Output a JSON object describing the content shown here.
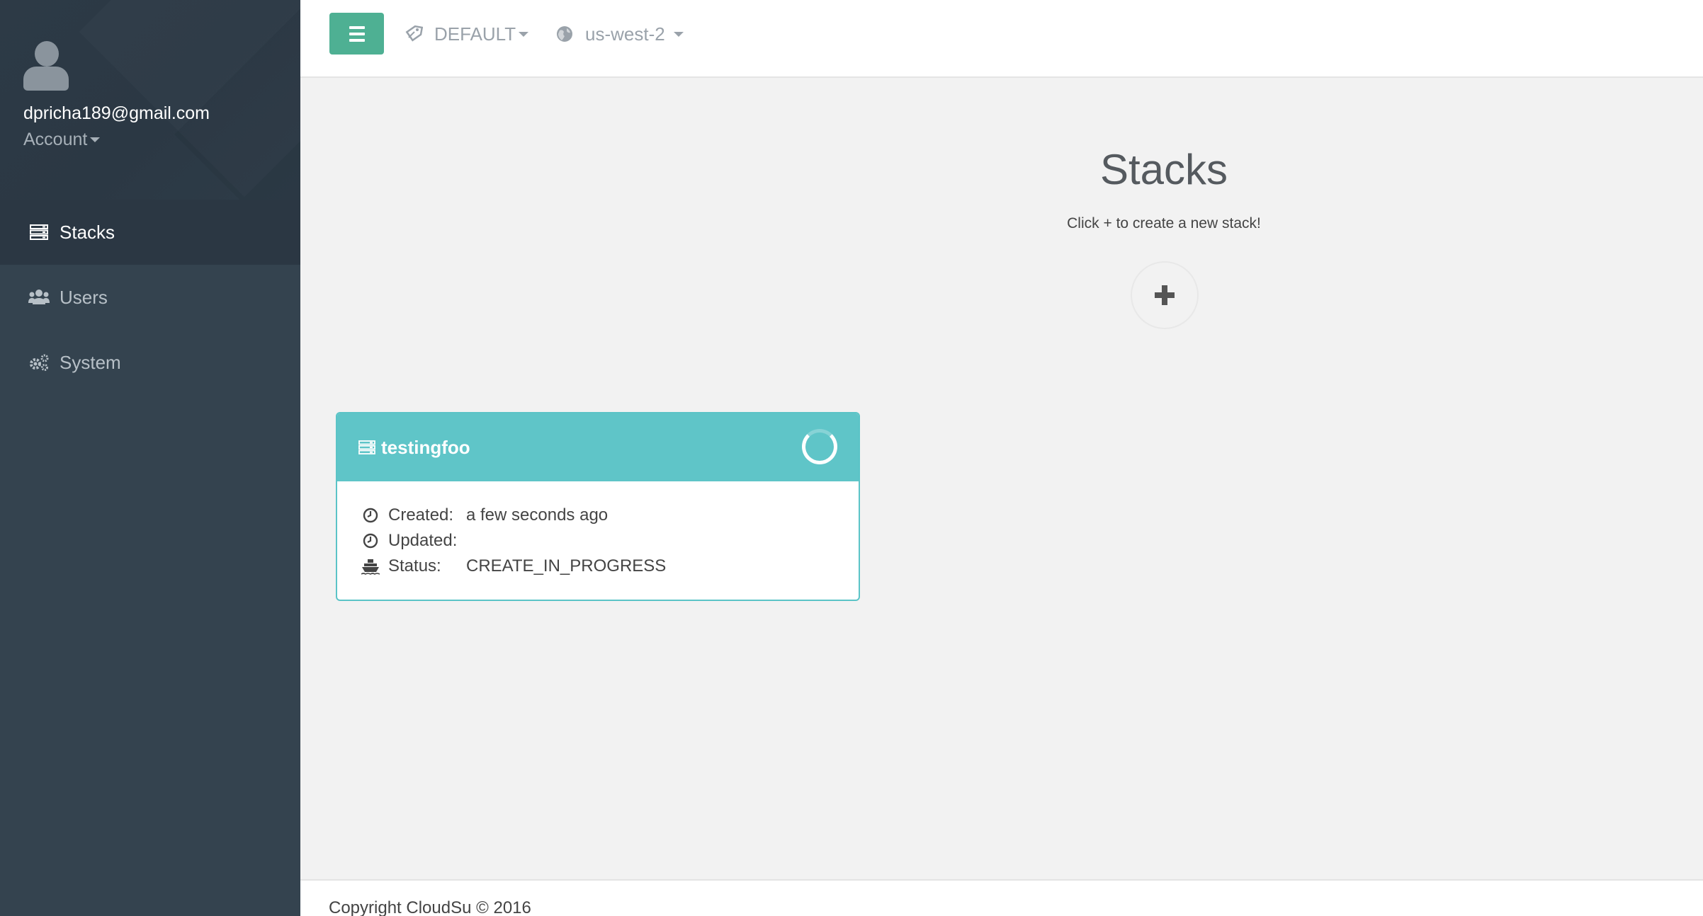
{
  "sidebar": {
    "user_email": "dpricha189@gmail.com",
    "account_label": "Account",
    "items": [
      {
        "label": "Stacks",
        "icon": "server-icon",
        "active": true
      },
      {
        "label": "Users",
        "icon": "users-icon",
        "active": false
      },
      {
        "label": "System",
        "icon": "cogs-icon",
        "active": false
      }
    ]
  },
  "topbar": {
    "menu_icon": "hamburger-icon",
    "profile_selector": {
      "value": "DEFAULT",
      "icon": "tag-icon"
    },
    "region_selector": {
      "value": "us-west-2",
      "icon": "globe-icon"
    }
  },
  "main": {
    "title": "Stacks",
    "subtitle": "Click + to create a new stack!",
    "add_button_icon": "plus-icon"
  },
  "stacks": [
    {
      "name": "testingfoo",
      "created_label": "Created:",
      "created_value": "a few seconds ago",
      "updated_label": "Updated:",
      "updated_value": "",
      "status_label": "Status:",
      "status_value": "CREATE_IN_PROGRESS"
    }
  ],
  "footer": {
    "text": "Copyright CloudSu © 2016"
  },
  "colors": {
    "sidebar_bg": "#34434f",
    "accent_green": "#4eb093",
    "card_teal": "#5fc5c8"
  }
}
